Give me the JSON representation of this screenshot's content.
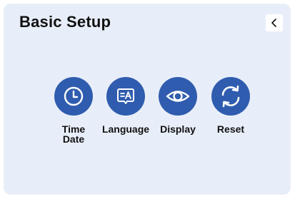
{
  "header": {
    "title": "Basic Setup"
  },
  "icons": {
    "back": "chevron-left-icon",
    "time_date": "clock-icon",
    "language": "language-icon",
    "display": "eye-icon",
    "reset": "refresh-icon"
  },
  "menu": {
    "time_date_line1": "Time",
    "time_date_line2": "Date",
    "language": "Language",
    "display": "Display",
    "reset": "Reset"
  },
  "colors": {
    "panel_background": "#e8eef9",
    "button_fill": "#2f5cae",
    "icon_stroke": "#ffffff"
  }
}
